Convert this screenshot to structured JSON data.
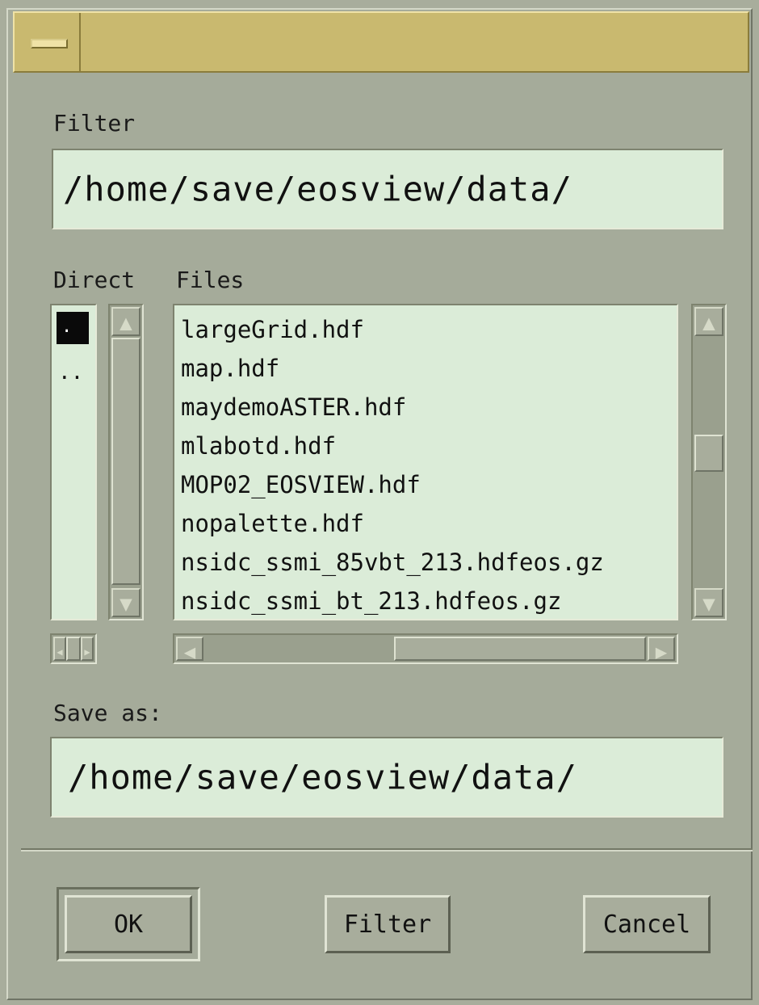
{
  "filter": {
    "label": "Filter",
    "value": "/home/save/eosview/data/"
  },
  "directories": {
    "label": "Direct",
    "items": [
      ".",
      ".."
    ]
  },
  "files": {
    "label": "Files",
    "items": [
      "largeGrid.hdf",
      "map.hdf",
      "maydemoASTER.hdf",
      "mlabotd.hdf",
      "MOP02_EOSVIEW.hdf",
      "nopalette.hdf",
      "nsidc_ssmi_85vbt_213.hdfeos.gz",
      "nsidc_ssmi_bt_213.hdfeos.gz"
    ]
  },
  "save_as": {
    "label": "Save as:",
    "value": "/home/save/eosview/data/"
  },
  "buttons": {
    "ok": "OK",
    "filter": "Filter",
    "cancel": "Cancel"
  },
  "icons": {
    "window_menu": "window-menu-icon",
    "arrows": [
      "arrow-up-icon",
      "arrow-down-icon",
      "arrow-left-icon",
      "arrow-right-icon"
    ]
  },
  "colors": {
    "background": "#a8ad9c",
    "field": "#dbecd8",
    "titlebar": "#c9b96f"
  }
}
